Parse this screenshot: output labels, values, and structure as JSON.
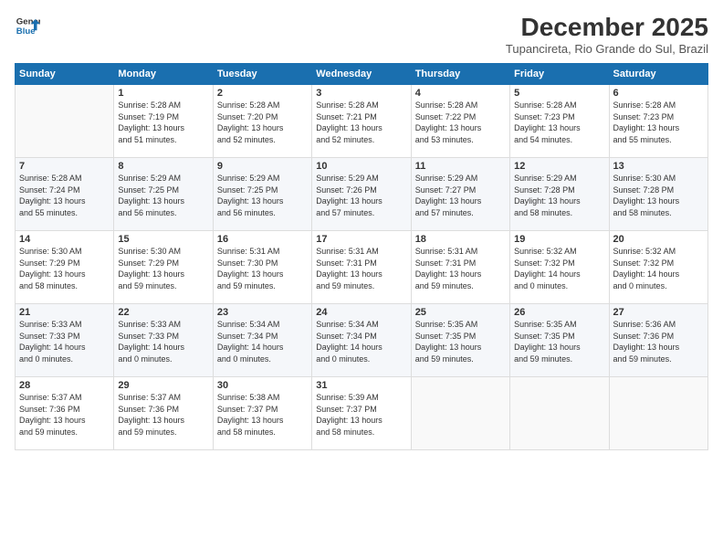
{
  "logo": {
    "line1": "General",
    "line2": "Blue"
  },
  "title": "December 2025",
  "location": "Tupancireta, Rio Grande do Sul, Brazil",
  "days_header": [
    "Sunday",
    "Monday",
    "Tuesday",
    "Wednesday",
    "Thursday",
    "Friday",
    "Saturday"
  ],
  "weeks": [
    [
      {
        "day": "",
        "info": ""
      },
      {
        "day": "1",
        "info": "Sunrise: 5:28 AM\nSunset: 7:19 PM\nDaylight: 13 hours\nand 51 minutes."
      },
      {
        "day": "2",
        "info": "Sunrise: 5:28 AM\nSunset: 7:20 PM\nDaylight: 13 hours\nand 52 minutes."
      },
      {
        "day": "3",
        "info": "Sunrise: 5:28 AM\nSunset: 7:21 PM\nDaylight: 13 hours\nand 52 minutes."
      },
      {
        "day": "4",
        "info": "Sunrise: 5:28 AM\nSunset: 7:22 PM\nDaylight: 13 hours\nand 53 minutes."
      },
      {
        "day": "5",
        "info": "Sunrise: 5:28 AM\nSunset: 7:23 PM\nDaylight: 13 hours\nand 54 minutes."
      },
      {
        "day": "6",
        "info": "Sunrise: 5:28 AM\nSunset: 7:23 PM\nDaylight: 13 hours\nand 55 minutes."
      }
    ],
    [
      {
        "day": "7",
        "info": "Sunrise: 5:28 AM\nSunset: 7:24 PM\nDaylight: 13 hours\nand 55 minutes."
      },
      {
        "day": "8",
        "info": "Sunrise: 5:29 AM\nSunset: 7:25 PM\nDaylight: 13 hours\nand 56 minutes."
      },
      {
        "day": "9",
        "info": "Sunrise: 5:29 AM\nSunset: 7:25 PM\nDaylight: 13 hours\nand 56 minutes."
      },
      {
        "day": "10",
        "info": "Sunrise: 5:29 AM\nSunset: 7:26 PM\nDaylight: 13 hours\nand 57 minutes."
      },
      {
        "day": "11",
        "info": "Sunrise: 5:29 AM\nSunset: 7:27 PM\nDaylight: 13 hours\nand 57 minutes."
      },
      {
        "day": "12",
        "info": "Sunrise: 5:29 AM\nSunset: 7:28 PM\nDaylight: 13 hours\nand 58 minutes."
      },
      {
        "day": "13",
        "info": "Sunrise: 5:30 AM\nSunset: 7:28 PM\nDaylight: 13 hours\nand 58 minutes."
      }
    ],
    [
      {
        "day": "14",
        "info": "Sunrise: 5:30 AM\nSunset: 7:29 PM\nDaylight: 13 hours\nand 58 minutes."
      },
      {
        "day": "15",
        "info": "Sunrise: 5:30 AM\nSunset: 7:29 PM\nDaylight: 13 hours\nand 59 minutes."
      },
      {
        "day": "16",
        "info": "Sunrise: 5:31 AM\nSunset: 7:30 PM\nDaylight: 13 hours\nand 59 minutes."
      },
      {
        "day": "17",
        "info": "Sunrise: 5:31 AM\nSunset: 7:31 PM\nDaylight: 13 hours\nand 59 minutes."
      },
      {
        "day": "18",
        "info": "Sunrise: 5:31 AM\nSunset: 7:31 PM\nDaylight: 13 hours\nand 59 minutes."
      },
      {
        "day": "19",
        "info": "Sunrise: 5:32 AM\nSunset: 7:32 PM\nDaylight: 14 hours\nand 0 minutes."
      },
      {
        "day": "20",
        "info": "Sunrise: 5:32 AM\nSunset: 7:32 PM\nDaylight: 14 hours\nand 0 minutes."
      }
    ],
    [
      {
        "day": "21",
        "info": "Sunrise: 5:33 AM\nSunset: 7:33 PM\nDaylight: 14 hours\nand 0 minutes."
      },
      {
        "day": "22",
        "info": "Sunrise: 5:33 AM\nSunset: 7:33 PM\nDaylight: 14 hours\nand 0 minutes."
      },
      {
        "day": "23",
        "info": "Sunrise: 5:34 AM\nSunset: 7:34 PM\nDaylight: 14 hours\nand 0 minutes."
      },
      {
        "day": "24",
        "info": "Sunrise: 5:34 AM\nSunset: 7:34 PM\nDaylight: 14 hours\nand 0 minutes."
      },
      {
        "day": "25",
        "info": "Sunrise: 5:35 AM\nSunset: 7:35 PM\nDaylight: 13 hours\nand 59 minutes."
      },
      {
        "day": "26",
        "info": "Sunrise: 5:35 AM\nSunset: 7:35 PM\nDaylight: 13 hours\nand 59 minutes."
      },
      {
        "day": "27",
        "info": "Sunrise: 5:36 AM\nSunset: 7:36 PM\nDaylight: 13 hours\nand 59 minutes."
      }
    ],
    [
      {
        "day": "28",
        "info": "Sunrise: 5:37 AM\nSunset: 7:36 PM\nDaylight: 13 hours\nand 59 minutes."
      },
      {
        "day": "29",
        "info": "Sunrise: 5:37 AM\nSunset: 7:36 PM\nDaylight: 13 hours\nand 59 minutes."
      },
      {
        "day": "30",
        "info": "Sunrise: 5:38 AM\nSunset: 7:37 PM\nDaylight: 13 hours\nand 58 minutes."
      },
      {
        "day": "31",
        "info": "Sunrise: 5:39 AM\nSunset: 7:37 PM\nDaylight: 13 hours\nand 58 minutes."
      },
      {
        "day": "",
        "info": ""
      },
      {
        "day": "",
        "info": ""
      },
      {
        "day": "",
        "info": ""
      }
    ]
  ]
}
